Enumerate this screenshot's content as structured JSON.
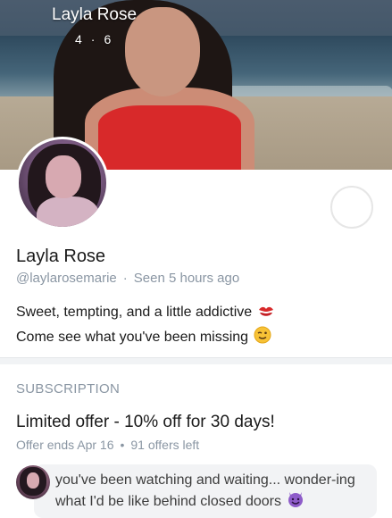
{
  "cover": {
    "title": "Layla Rose",
    "stat_a": "4",
    "stat_b": "6"
  },
  "profile": {
    "name": "Layla Rose",
    "handle": "@laylarosemarie",
    "last_seen": "Seen 5 hours ago",
    "bio_line1": "Sweet, tempting, and a little addictive",
    "bio_line2": "Come see what you've been missing",
    "bio_icons": [
      "kiss-mark-icon",
      "winking-face-icon"
    ]
  },
  "subscription": {
    "section_title": "SUBSCRIPTION",
    "offer_title": "Limited offer - 10% off for 30 days!",
    "offer_ends": "Offer ends Apr 16",
    "offers_left": "91 offers left"
  },
  "message": {
    "text": "you've been watching and waiting... wonder-ing what I'd be like behind closed doors",
    "icon": "smiling-devil-icon"
  },
  "colors": {
    "muted": "#8a96a3",
    "text": "#1a1a1a",
    "accent_red": "#d8292a",
    "devil_purple": "#8e5cc9"
  }
}
